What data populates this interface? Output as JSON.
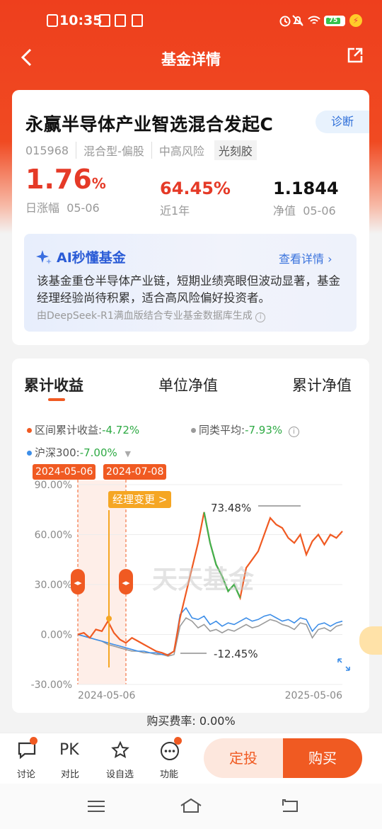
{
  "status_bar": {
    "time": "10:35",
    "battery": "75"
  },
  "nav": {
    "title": "基金详情"
  },
  "fund": {
    "name": "永赢半导体产业智选混合发起C",
    "diagnose_label": "诊断",
    "code": "015968",
    "type": "混合型-偏股",
    "risk": "中高风险",
    "theme_tag": "光刻胶",
    "daily_change": "1.76",
    "daily_change_unit": "%",
    "daily_change_label": "日涨幅",
    "daily_change_date": "05-06",
    "year_return": "64.45%",
    "year_return_label": "近1年",
    "nav_value": "1.1844",
    "nav_label": "净值",
    "nav_date": "05-06"
  },
  "ai": {
    "title": "AI秒懂基金",
    "more_label": "查看详情",
    "summary": "该基金重仓半导体产业链，短期业绩亮眼但波动显著，基金经理经验尚待积累，适合高风险偏好投资者。",
    "source": "由DeepSeek-R1满血版结合专业基金数据库生成"
  },
  "tabs": [
    {
      "label": "累计收益",
      "active": true
    },
    {
      "label": "单位净值",
      "active": false
    },
    {
      "label": "累计净值",
      "active": false
    }
  ],
  "legend": {
    "fund_label": "区间累计收益:",
    "fund_value": "-4.72%",
    "peer_label": "同类平均:",
    "peer_value": "-7.93%",
    "index_label": "沪深300:",
    "index_value": "-7.00%"
  },
  "chart_overlay": {
    "range_start": "2024-05-06",
    "range_end": "2024-07-08",
    "manager_change_label": "经理变更 >",
    "max_label": "73.48%",
    "min_label": "-12.45%",
    "watermark": "天天基金"
  },
  "chart_data": {
    "type": "line",
    "y_ticks": [
      "90.00%",
      "60.00%",
      "30.00%",
      "0.00%",
      "-30.00%"
    ],
    "ylim": [
      -30,
      90
    ],
    "x_tick_labels": [
      "2024-05-06",
      "2025-05-06"
    ],
    "series": [
      {
        "name": "区间累计收益",
        "color": "#f05a22",
        "values": [
          0,
          1,
          -2,
          3,
          2,
          8,
          1,
          -3,
          -5,
          -2,
          -4,
          -6,
          -8,
          -10,
          -11,
          -12.45,
          -10,
          10,
          25,
          40,
          55,
          73.48,
          55,
          42,
          35,
          26,
          30,
          22,
          40,
          45,
          50,
          60,
          70,
          66,
          64,
          58,
          55,
          60,
          48,
          56,
          60,
          54,
          60,
          58,
          62
        ]
      },
      {
        "name": "同类平均",
        "color": "#9a9a9a",
        "values": [
          0,
          -1,
          -2,
          -3,
          -4,
          -6,
          -7,
          -8,
          -9,
          -10,
          -10,
          -11,
          -11,
          -12,
          -12,
          -13,
          -12,
          5,
          10,
          8,
          4,
          6,
          2,
          3,
          1,
          3,
          2,
          4,
          6,
          4,
          5,
          7,
          9,
          8,
          6,
          5,
          3,
          7,
          6,
          -2,
          3,
          4,
          2,
          5,
          6
        ]
      },
      {
        "name": "沪深300",
        "color": "#3d8ee8",
        "values": [
          0,
          -1,
          -2,
          -3,
          -4,
          -5,
          -6,
          -7,
          -8,
          -9,
          -10,
          -10,
          -11,
          -11,
          -12,
          -12,
          -10,
          12,
          16,
          10,
          9,
          11,
          6,
          8,
          5,
          7,
          6,
          8,
          10,
          8,
          9,
          11,
          12,
          10,
          8,
          9,
          7,
          10,
          9,
          2,
          6,
          7,
          5,
          7,
          8
        ]
      }
    ],
    "grid": true
  },
  "fee": {
    "label": "购买费率:",
    "value": "0.00%"
  },
  "bottom_bar": {
    "discuss": "讨论",
    "pk_icon_text": "PK",
    "compare": "对比",
    "watchlist": "设自选",
    "functions": "功能",
    "auto_invest": "定投",
    "buy": "购买"
  }
}
